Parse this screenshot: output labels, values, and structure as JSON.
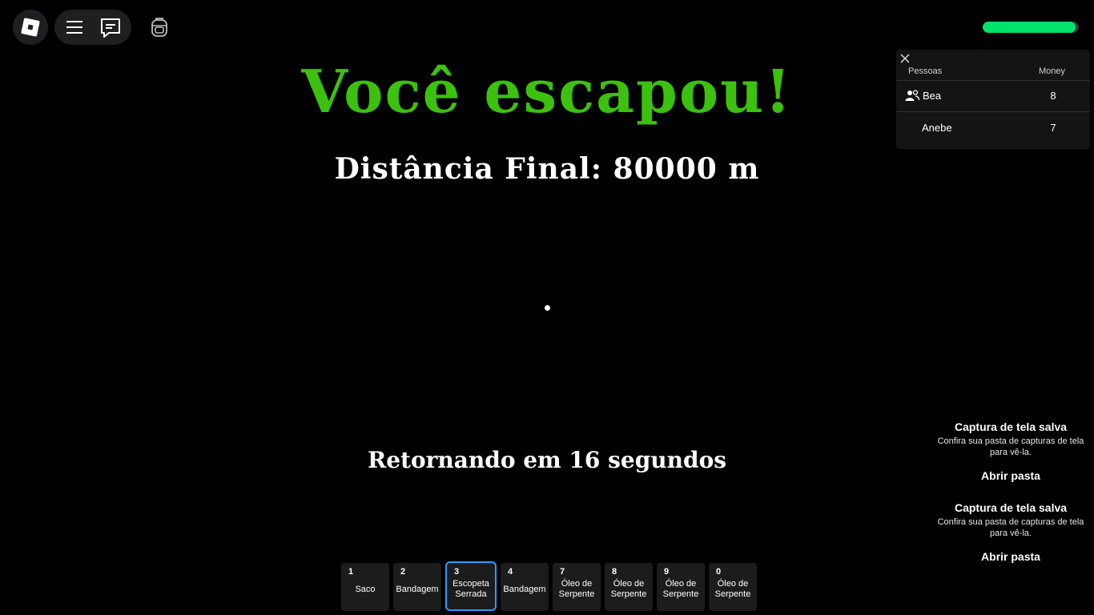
{
  "hud": {
    "health_fraction": 0.97,
    "health_color": "#00e36b"
  },
  "screen": {
    "title": "Você escapou!",
    "distance": "Distância Final: 80000 m",
    "returning": "Retornando em 16 segundos",
    "title_color": "#3cc10e"
  },
  "playerlist": {
    "col_people": "Pessoas",
    "col_money": "Money",
    "players": [
      {
        "name": "Bea",
        "money": "8"
      },
      {
        "name": "Anebe",
        "money": "7"
      }
    ]
  },
  "notifications": [
    {
      "title": "Captura de tela salva",
      "body": "Confira sua pasta de capturas de tela para vê-la.",
      "button": "Abrir pasta"
    },
    {
      "title": "Captura de tela salva",
      "body": "Confira sua pasta de capturas de tela para vê-la.",
      "button": "Abrir pasta"
    }
  ],
  "hotbar": {
    "selected_index": 2,
    "selected_color": "#2f9bff",
    "slots": [
      {
        "key": "1",
        "label": "Saco"
      },
      {
        "key": "2",
        "label": "Bandagem"
      },
      {
        "key": "3",
        "label": "Escopeta Serrada"
      },
      {
        "key": "4",
        "label": "Bandagem"
      },
      {
        "key": "7",
        "label": "Óleo de Serpente"
      },
      {
        "key": "8",
        "label": "Óleo de Serpente"
      },
      {
        "key": "9",
        "label": "Óleo de Serpente"
      },
      {
        "key": "0",
        "label": "Óleo de Serpente"
      }
    ]
  },
  "icons": [
    "roblox-logo-icon",
    "menu-icon",
    "chat-icon",
    "backpack-icon",
    "close-icon",
    "friends-icon"
  ]
}
